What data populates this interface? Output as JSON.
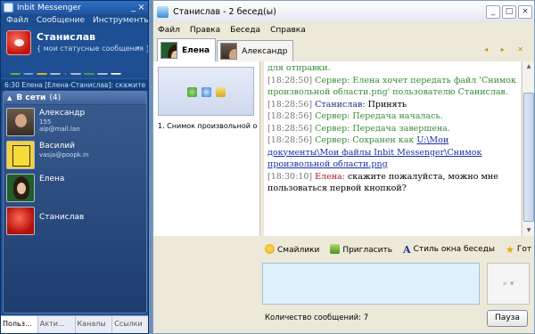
{
  "left": {
    "title": "Inbit Messenger",
    "window_buttons": [
      "_",
      "×"
    ],
    "menu": [
      "Файл",
      "Сообщение",
      "Инструменты"
    ],
    "profile": {
      "name": "Станислав",
      "status": "{ мои статусные сообщения }",
      "status_arrow": "▾"
    },
    "ticker": "6:30 Елена [Елена-Станислав]: скажите ...",
    "group": {
      "arrow": "▲",
      "label": "В сети",
      "count": "(4)"
    },
    "contacts": [
      {
        "name": "Александр",
        "line1": "155",
        "line2": "aip@mail.lan"
      },
      {
        "name": "Василий",
        "line1": "vasja@poopk.in",
        "line2": ""
      },
      {
        "name": "Елена",
        "line1": "",
        "line2": ""
      },
      {
        "name": "Станислав",
        "line1": "",
        "line2": ""
      }
    ],
    "bottom_tabs": [
      "Польз...",
      "Акти...",
      "Каналы",
      "Ссылки"
    ]
  },
  "right": {
    "title": "Станислав - 2 бесед(ы)",
    "window_buttons": [
      "_",
      "□",
      "×"
    ],
    "menu": [
      "Файл",
      "Правка",
      "Беседа",
      "Справка"
    ],
    "tabs": [
      "Елена",
      "Александр"
    ],
    "tab_nav": "◂ ▸ ✕",
    "thumb_caption": "1. Снимок произвольной о",
    "log": [
      {
        "ts": "",
        "who": "",
        "text": "для отправки."
      },
      {
        "ts": "[18:28:50]",
        "who": "Сервер:",
        "text": "Елена хочет передать файл 'Снимок произвольной области.png' пользователю Станислав."
      },
      {
        "ts": "[18:28:56]",
        "who": "Станислав:",
        "text": "Принять"
      },
      {
        "ts": "[18:28:56]",
        "who": "Сервер:",
        "text": "Передача началась."
      },
      {
        "ts": "[18:28:56]",
        "who": "Сервер:",
        "text": "Передача завершена."
      },
      {
        "ts": "[18:28:56]",
        "who": "Сервер:",
        "text": "Сохранен как",
        "link": "U:\\Мои документы\\Мои файлы Inbit Messenger\\Снимок произвольной области.png"
      },
      {
        "ts": "[18:30:10]",
        "who": "Елена:",
        "text": "скажите пожалуйста, можно мне пользоваться первой кнопкой?"
      }
    ],
    "toolbar": {
      "smileys": "Смайлики",
      "invite": "Пригласить",
      "style": "Стиль окна беседы",
      "ready": "Гот"
    },
    "send_label": "» ▾",
    "message_count": "Количество сообщений: 7",
    "pause": "Пауза"
  }
}
